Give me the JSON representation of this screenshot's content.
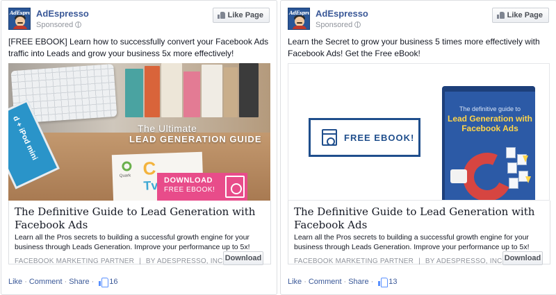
{
  "ads": [
    {
      "page_name": "AdEspresso",
      "logo_text": "AdEspresso",
      "sponsored": "Sponsored",
      "like_page_label": "Like Page",
      "body_text": "[FREE EBOOK] Learn how to successfully convert your Facebook Ads traffic into Leads and grow your business 5x more effectively!",
      "image": {
        "ipad_label": "d + iPod mini",
        "heading_line1": "The Ultimate",
        "heading_line2": "LEAD GENERATION GUIDE",
        "paper_letter1": "C",
        "paper_letter2": "Tv",
        "paper_small": "Quark",
        "cta_line1": "DOWNLOAD",
        "cta_line2": "FREE EBOOK!",
        "accent_color": "#e84c8a"
      },
      "link_title": "The Definitive Guide to Lead Generation with Facebook Ads",
      "link_description": "Learn all the Pros secrets to building a successful growth engine for your business through Leads Generation. Improve your performance up to 5x!",
      "source_left": "FACEBOOK MARKETING PARTNER",
      "source_sep": "|",
      "source_right": "BY ADESPRESSO, INC",
      "cta_button": "Download",
      "actions": {
        "like": "Like",
        "comment": "Comment",
        "share": "Share",
        "dot": "·",
        "like_count": "16"
      }
    },
    {
      "page_name": "AdEspresso",
      "logo_text": "AdEspresso",
      "sponsored": "Sponsored",
      "like_page_label": "Like Page",
      "body_text": "Learn the Secret to grow your business 5 times more effectively with Facebook Ads! Get the Free eBook!",
      "image": {
        "free_ebook": "FREE EBOOK!",
        "book_subtitle": "The definitive guide to",
        "book_title": "Lead Generation with Facebook Ads",
        "accent_color": "#1f4e8c"
      },
      "link_title": "The Definitive Guide to Lead Generation with Facebook Ads",
      "link_description": "Learn all the Pros secrets to building a successful growth engine for your business through Leads Generation. Improve your performance up to 5x!",
      "source_left": "FACEBOOK MARKETING PARTNER",
      "source_sep": "|",
      "source_right": "BY ADESPRESSO, INC",
      "cta_button": "Download",
      "actions": {
        "like": "Like",
        "comment": "Comment",
        "share": "Share",
        "dot": "·",
        "like_count": "13"
      }
    }
  ]
}
